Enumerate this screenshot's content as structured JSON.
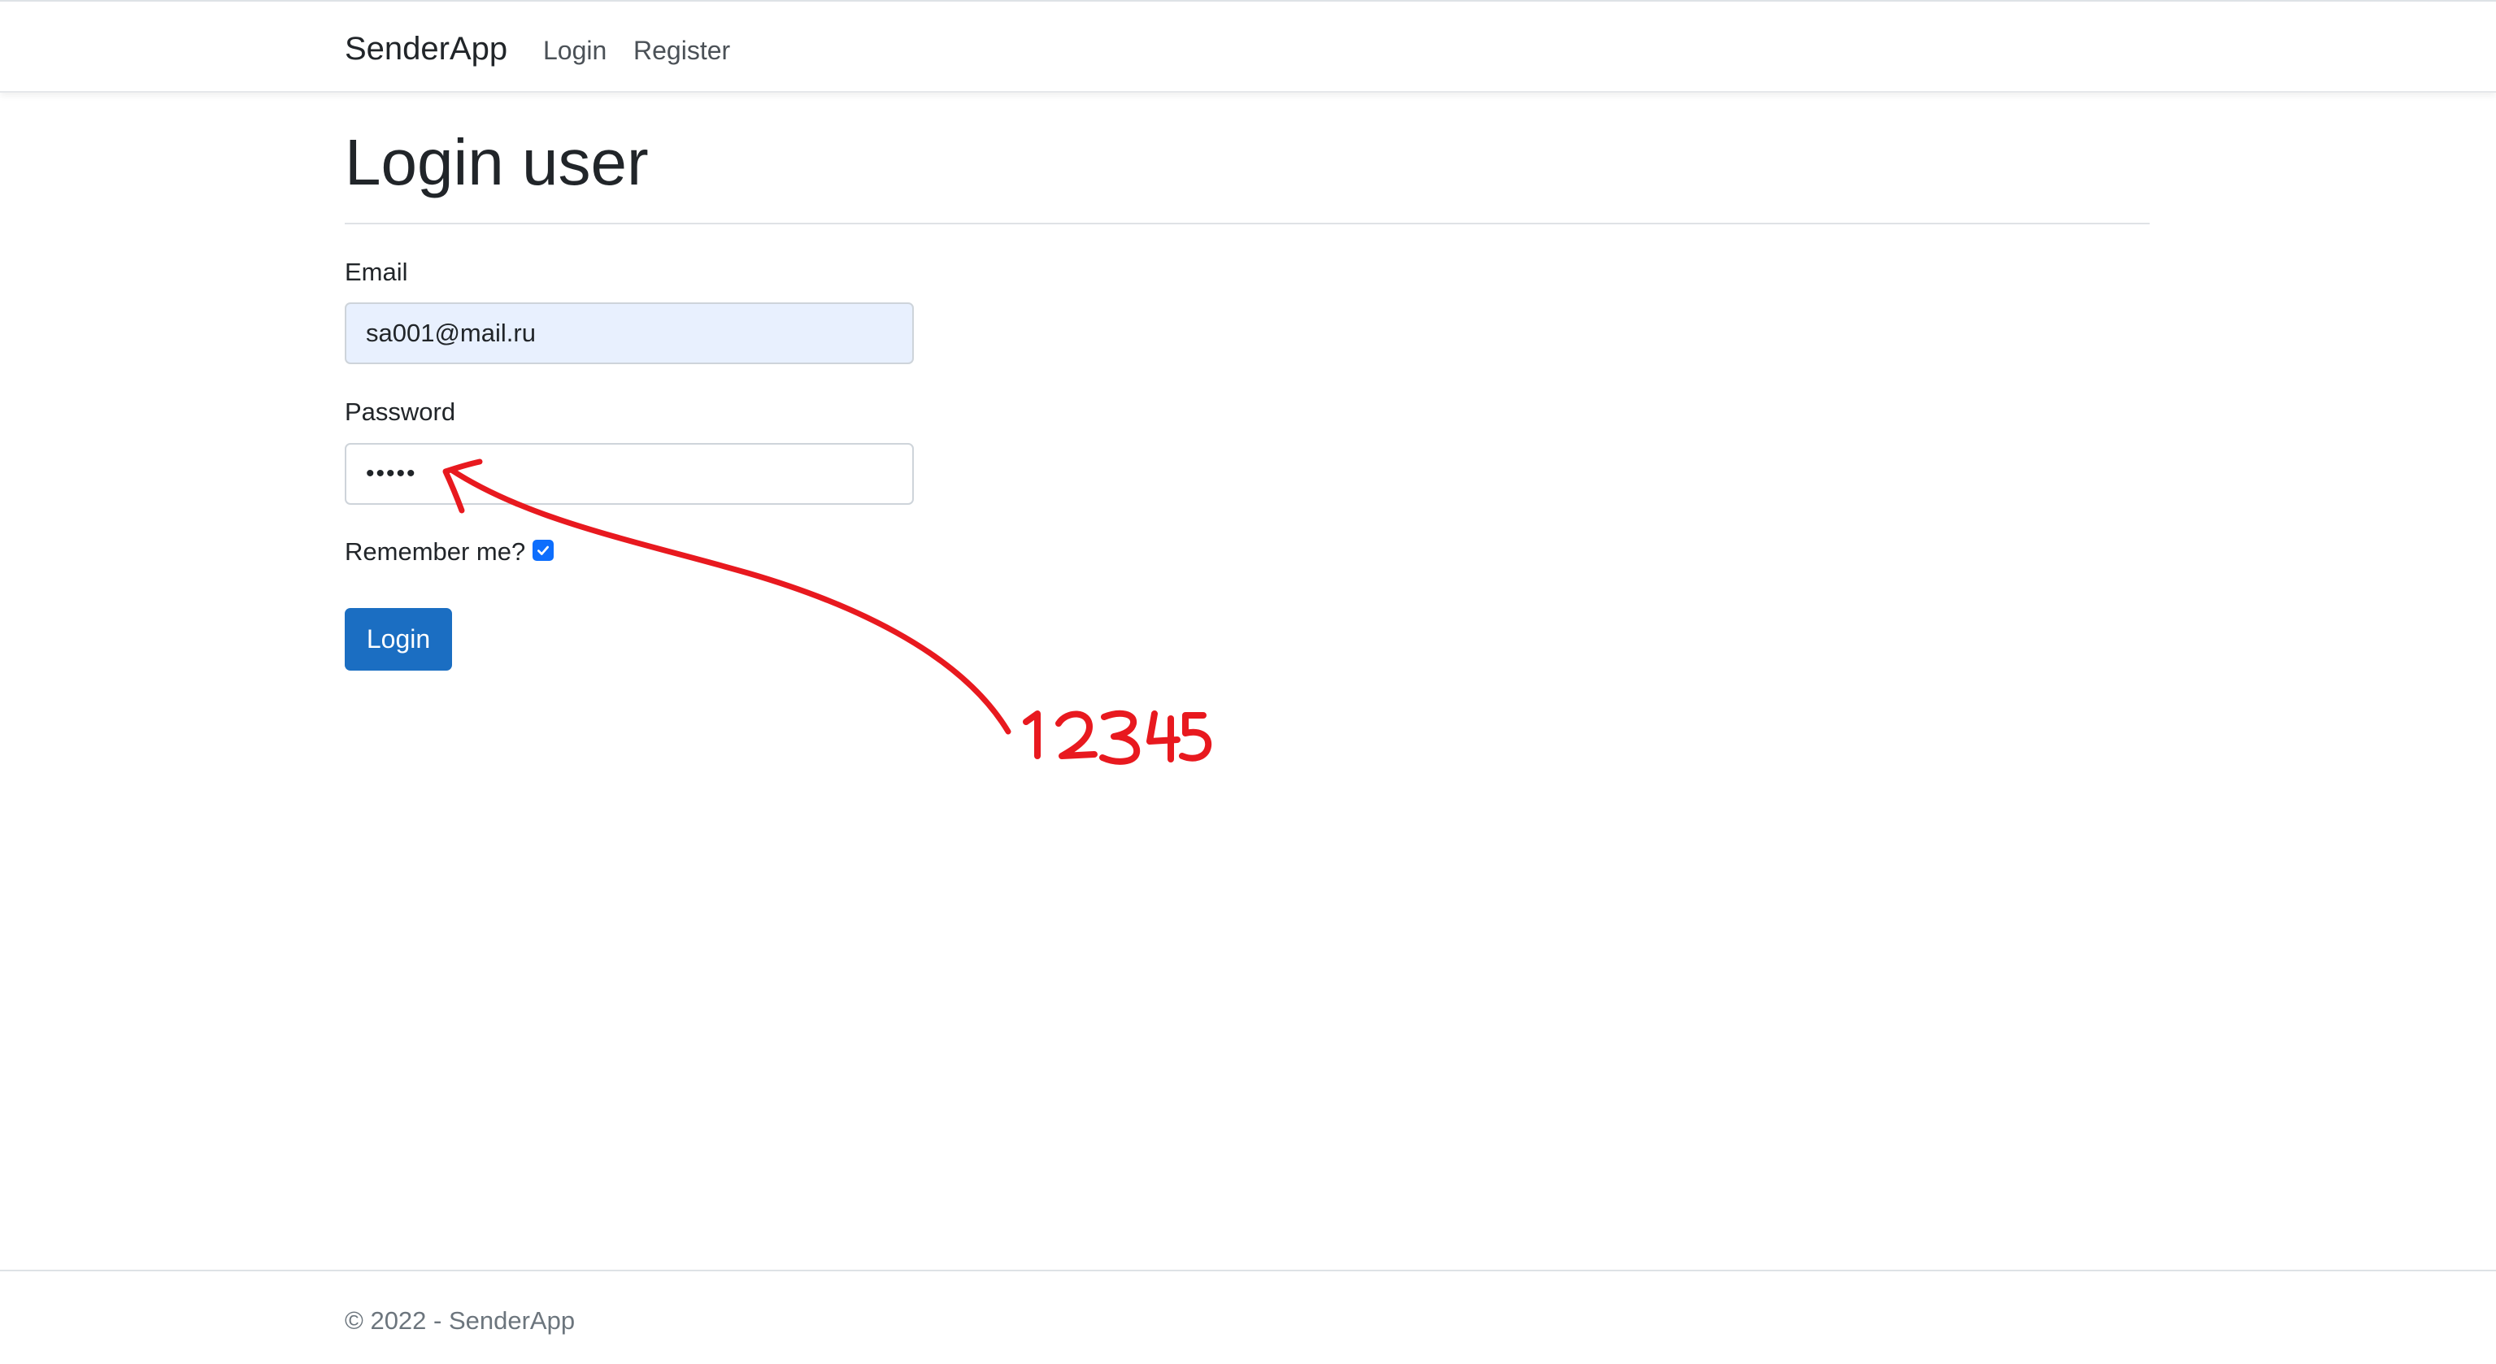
{
  "navbar": {
    "brand": "SenderApp",
    "links": [
      {
        "label": "Login"
      },
      {
        "label": "Register"
      }
    ]
  },
  "main": {
    "title": "Login user",
    "form": {
      "email_label": "Email",
      "email_value": "sa001@mail.ru",
      "password_label": "Password",
      "password_value": "•••••",
      "remember_label": "Remember me?",
      "remember_checked": true,
      "submit_label": "Login"
    }
  },
  "annotation": {
    "text": "12345",
    "color": "#e8191f"
  },
  "footer": {
    "text": "© 2022 - SenderApp"
  },
  "colors": {
    "primary_button": "#1b6ec2",
    "autofill_background": "#e8f0fe",
    "checkbox": "#0d6efd"
  }
}
